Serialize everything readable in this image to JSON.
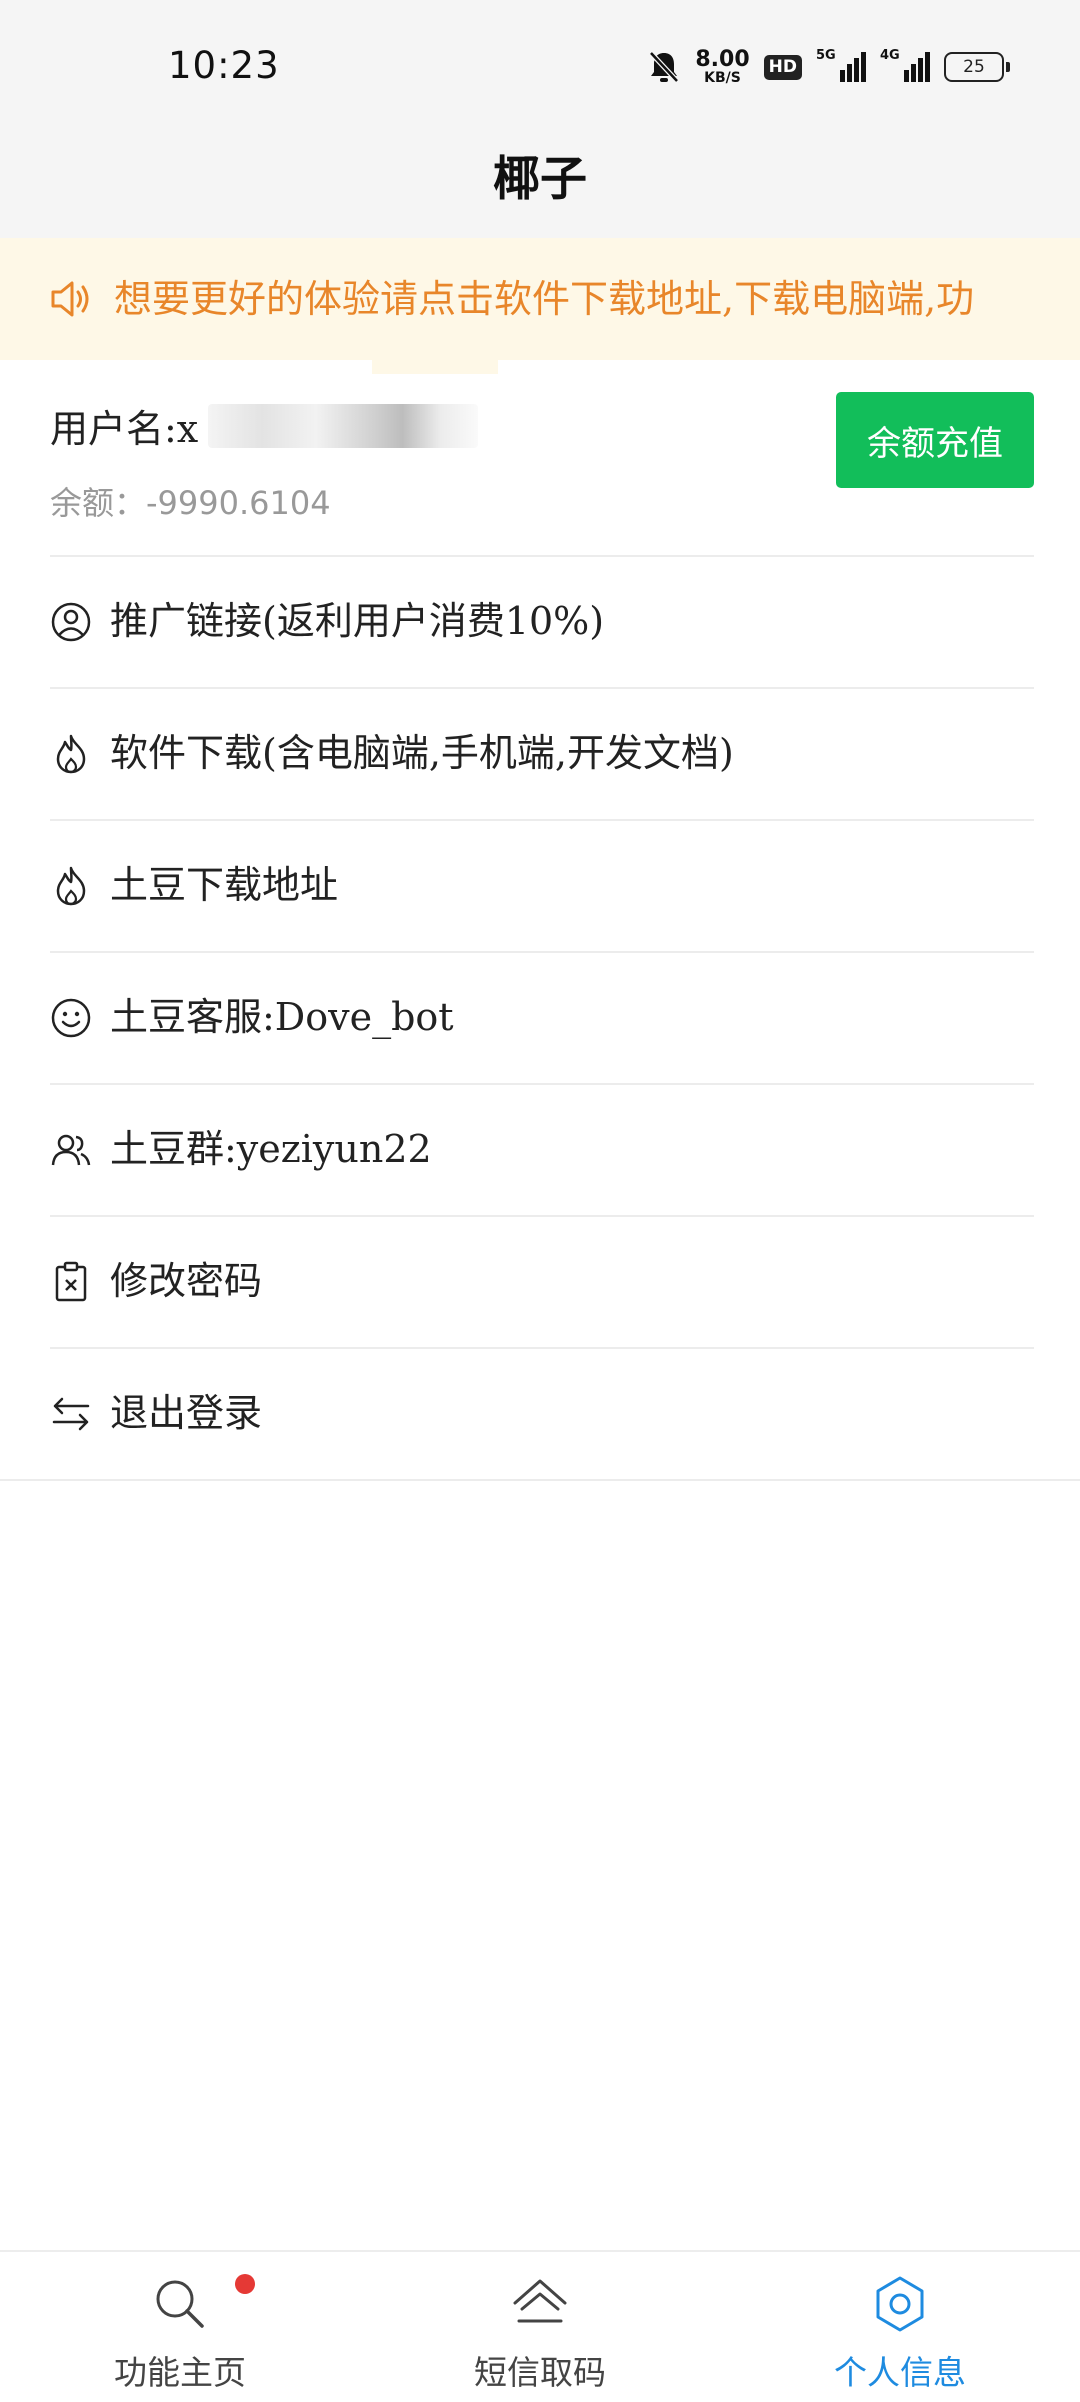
{
  "status_bar": {
    "time": "10:23",
    "net_speed": "8.00",
    "net_speed_unit": "KB/S",
    "hd_label": "HD",
    "sig1": "5G",
    "sig2": "4G",
    "battery": "25",
    "icons": [
      "bell-muted-icon",
      "hd-icon",
      "signal-5g-icon",
      "signal-4g-icon",
      "battery-icon"
    ]
  },
  "header": {
    "title": "椰子"
  },
  "notice": {
    "text": "想要更好的体验请点击软件下载地址,下载电脑端,功",
    "icon": "speaker-icon",
    "color": "#e8862a"
  },
  "user": {
    "username_label": "用户名:x",
    "balance_text": "余额：-9990.6104",
    "recharge_label": "余额充值"
  },
  "menu": [
    {
      "label": "推广链接(返利用户消费10%)",
      "icon": "user-circle-icon"
    },
    {
      "label": "软件下载(含电脑端,手机端,开发文档)",
      "icon": "flame-icon"
    },
    {
      "label": "土豆下载地址",
      "icon": "flame-icon"
    },
    {
      "label": "土豆客服:Dove_bot",
      "icon": "smile-icon"
    },
    {
      "label": "土豆群:yeziyun22",
      "icon": "users-icon"
    },
    {
      "label": "修改密码",
      "icon": "clipboard-x-icon"
    },
    {
      "label": "退出登录",
      "icon": "swap-arrows-icon"
    }
  ],
  "tabbar": [
    {
      "label": "功能主页",
      "icon": "search-icon",
      "badge": true
    },
    {
      "label": "短信取码",
      "icon": "home-icon"
    },
    {
      "label": "个人信息",
      "icon": "gear-icon",
      "active": true
    }
  ],
  "colors": {
    "accent": "#1e8be0",
    "recharge": "#12be5a",
    "notice_bg": "#fef8e7",
    "badge": "#e53935"
  }
}
